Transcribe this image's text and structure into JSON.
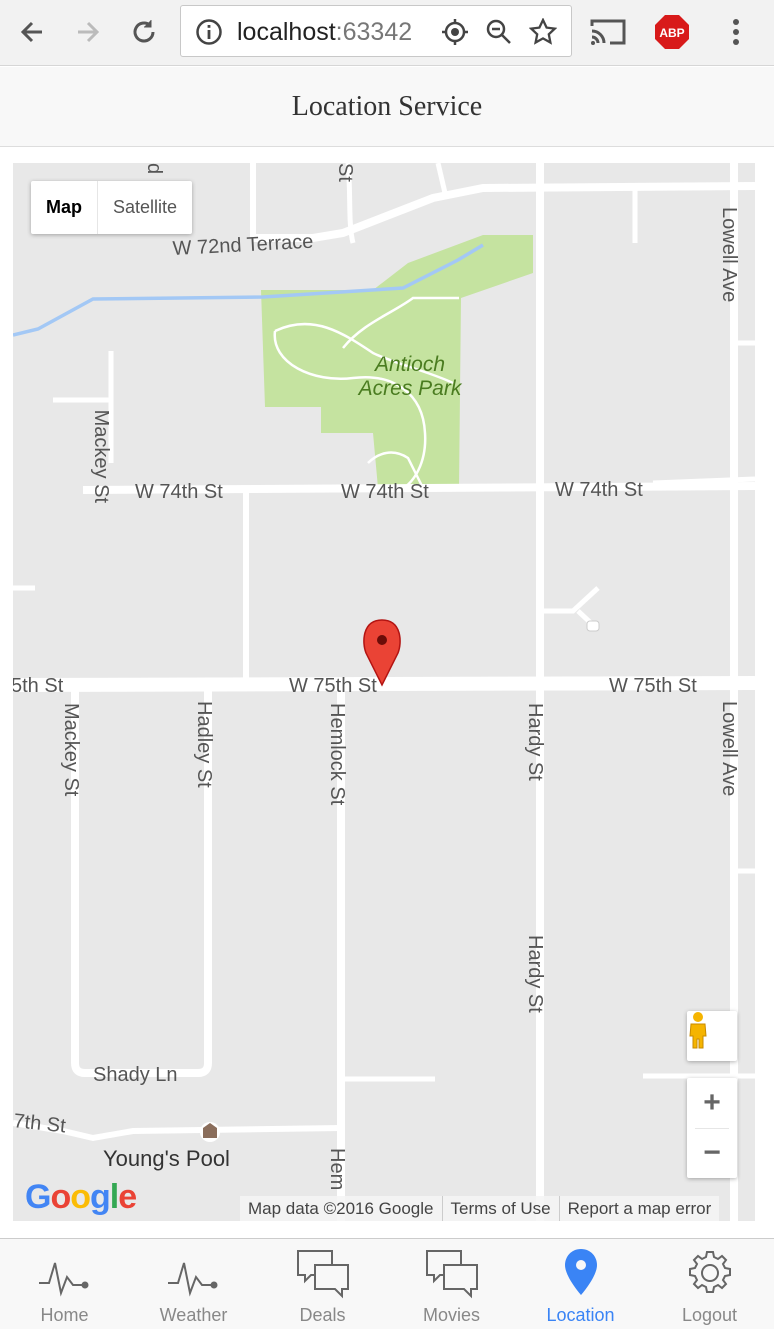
{
  "browser": {
    "url_host": "localhost",
    "url_port": ":63342",
    "extension_badge": "ABP"
  },
  "header": {
    "title": "Location Service"
  },
  "map": {
    "type_control": {
      "map_label": "Map",
      "satellite_label": "Satellite"
    },
    "park_name_line1": "Antioch",
    "park_name_line2": "Acres Park",
    "streets": {
      "terrace": "W 72nd Terrace",
      "st74_a": "W 74th St",
      "st74_b": "W 74th St",
      "st74_c": "W 74th St",
      "st75_left": "5th St",
      "st75_mid": "W 75th St",
      "st75_right": "W 75th St",
      "st77": "7th St",
      "mackey_top": "Mackey St",
      "mackey_bottom": "Mackey St",
      "hadley": "Hadley St",
      "hemlock": "Hemlock St",
      "hemlock_bottom": "Hem",
      "hardy_top": "Hardy St",
      "hardy_bottom": "Hardy St",
      "lowell_top": "Lowell Ave",
      "lowell_bottom": "Lowell Ave",
      "shady": "Shady Ln",
      "top_st": "St",
      "top_d": "d"
    },
    "poi": "Young's Pool",
    "logo": "Google",
    "attribution": {
      "data": "Map data ©2016 Google",
      "terms": "Terms of Use",
      "report": "Report a map error"
    },
    "zoom_in": "+",
    "zoom_out": "−",
    "colors": {
      "road": "#ffffff",
      "land": "#e8e8e8",
      "park": "#c5e3a0",
      "water": "#a3c8f5",
      "marker": "#ea4335"
    }
  },
  "tabs": [
    {
      "label": "Home",
      "icon": "pulse-icon"
    },
    {
      "label": "Weather",
      "icon": "pulse-icon"
    },
    {
      "label": "Deals",
      "icon": "chat-bubbles-icon"
    },
    {
      "label": "Movies",
      "icon": "chat-bubbles-icon"
    },
    {
      "label": "Location",
      "icon": "location-pin-icon",
      "active": true
    },
    {
      "label": "Logout",
      "icon": "gear-icon"
    }
  ],
  "accent_color": "#3a84f5"
}
